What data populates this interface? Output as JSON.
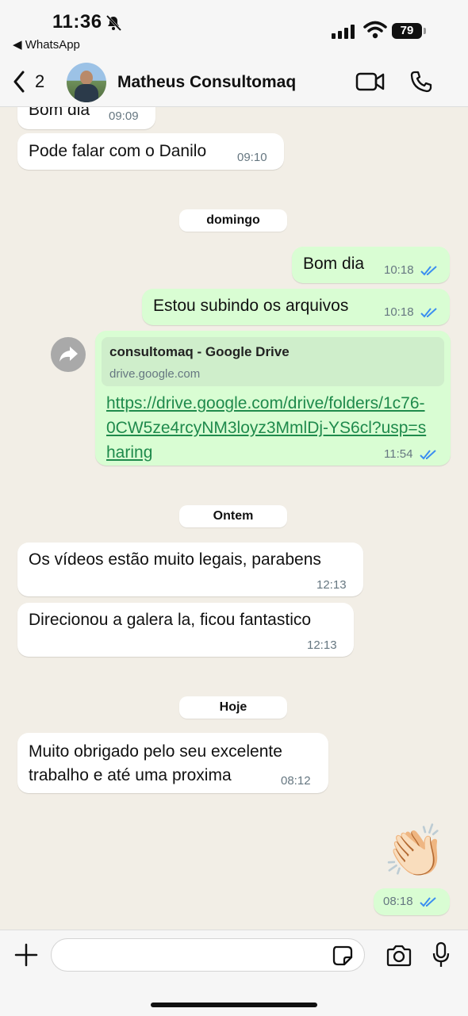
{
  "status": {
    "time": "11:36",
    "back_app": "◀ WhatsApp",
    "battery": "79"
  },
  "header": {
    "back_count": "2",
    "contact_name": "Matheus Consultomaq"
  },
  "messages": [
    {
      "text": "Bom dia",
      "time": "09:09"
    },
    {
      "text": "Pode falar com o Danilo",
      "time": "09:10"
    },
    {
      "separator": "domingo"
    },
    {
      "text": "Bom dia",
      "time": "10:18"
    },
    {
      "text": "Estou subindo os arquivos",
      "time": "10:18"
    },
    {
      "preview_title": "consultomaq - Google Drive",
      "preview_domain": "drive.google.com",
      "link": "https://drive.google.com/drive/folders/1c76-0CW5ze4rcyNM3loyz3MmlDj-YS6cl?usp=sharing",
      "time": "11:54"
    },
    {
      "separator": "Ontem"
    },
    {
      "text": "Os vídeos estão muito legais, parabens",
      "time": "12:13"
    },
    {
      "text": "Direcionou a galera la, ficou fantastico",
      "time": "12:13"
    },
    {
      "separator": "Hoje"
    },
    {
      "text": "Muito obrigado pelo seu excelente trabalho e até uma proxima",
      "time": "08:12"
    },
    {
      "emoji": "👏🏻",
      "time": "08:18"
    }
  ],
  "composer": {
    "value": "",
    "placeholder": ""
  },
  "colors": {
    "incoming": "#ffffff",
    "outgoing": "#d9fdd3",
    "link": "#1f8a4c",
    "read_ticks": "#3b8ef0"
  },
  "icons": [
    "back-chevron-icon",
    "video-call-icon",
    "phone-icon",
    "bell-slash-icon",
    "share-icon",
    "plus-icon",
    "sticker-icon",
    "camera-icon",
    "microphone-icon",
    "double-check-icon"
  ]
}
